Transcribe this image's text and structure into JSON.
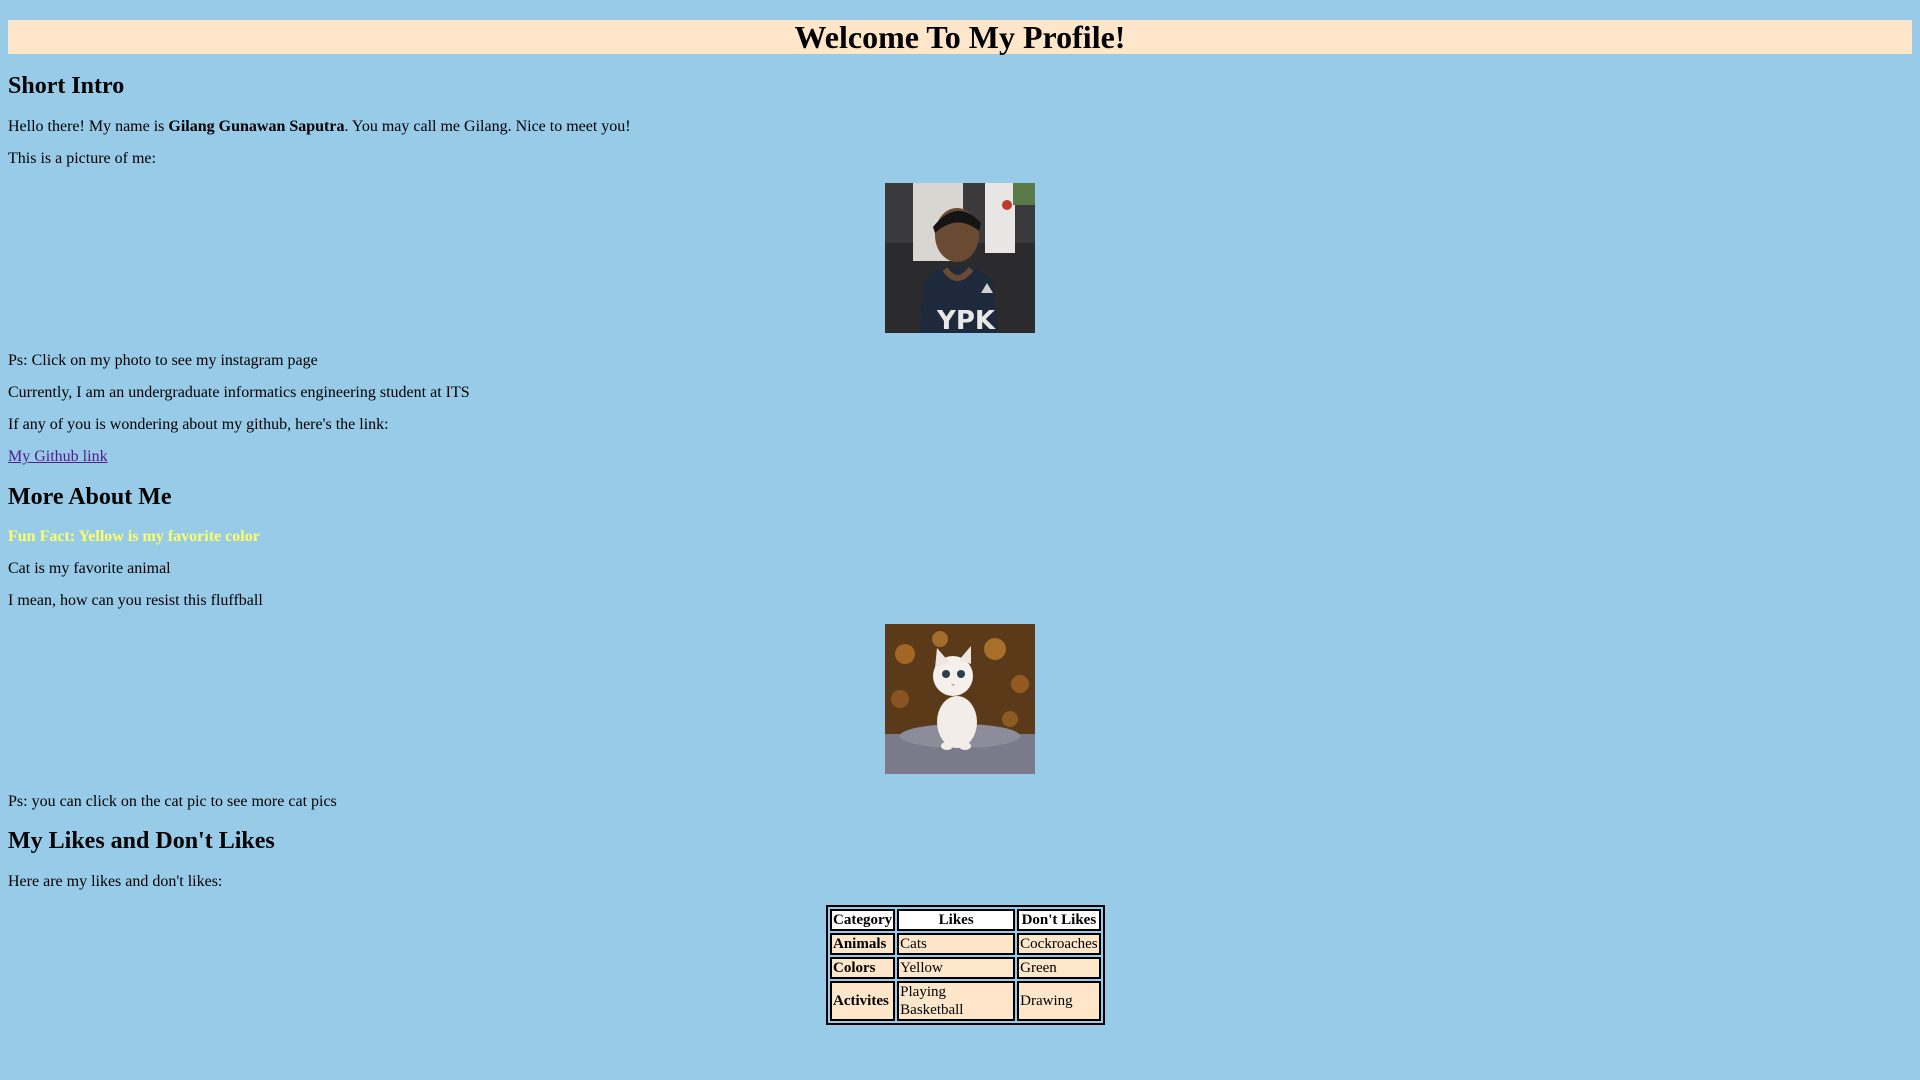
{
  "header": {
    "title": "Welcome To My Profile!"
  },
  "intro": {
    "heading": "Short Intro",
    "greeting_prefix": "Hello there! My name is ",
    "name": "Gilang Gunawan Saputra",
    "greeting_suffix": ". You may call me Gilang. Nice to meet you!",
    "picture_caption": "This is a picture of me:",
    "profile_photo": "profile-photo",
    "photo_note": "Ps: Click on my photo to see my instagram page",
    "current_status": "Currently, I am an undergraduate informatics engineering student at ITS",
    "github_prompt": "If any of you is wondering about my github, here's the link:",
    "github_link_text": "My Github link"
  },
  "more": {
    "heading": "More About Me",
    "fun_fact": "Fun Fact: Yellow is my favorite color",
    "fun_fact_color": "#ffff66",
    "favorite_animal": "Cat is my favorite animal",
    "resist_text": "I mean, how can you resist this fluffball",
    "cat_photo": "cat-photo",
    "cat_note": "Ps: you can click on the cat pic to see more cat pics"
  },
  "likes": {
    "heading": "My Likes and Don't Likes",
    "intro": "Here are my likes and don't likes:",
    "columns": [
      "Category",
      "Likes",
      "Don't Likes"
    ],
    "rows": [
      {
        "category": "Animals",
        "likes": "Cats",
        "dislikes": "Cockroaches"
      },
      {
        "category": "Colors",
        "likes": "Yellow",
        "dislikes": "Green"
      },
      {
        "category": "Activites",
        "likes": "Playing Basketball",
        "dislikes": "Drawing"
      }
    ]
  },
  "colors": {
    "background": "#97cbe8",
    "banner": "#fde6c9",
    "link": "#551a8b"
  }
}
